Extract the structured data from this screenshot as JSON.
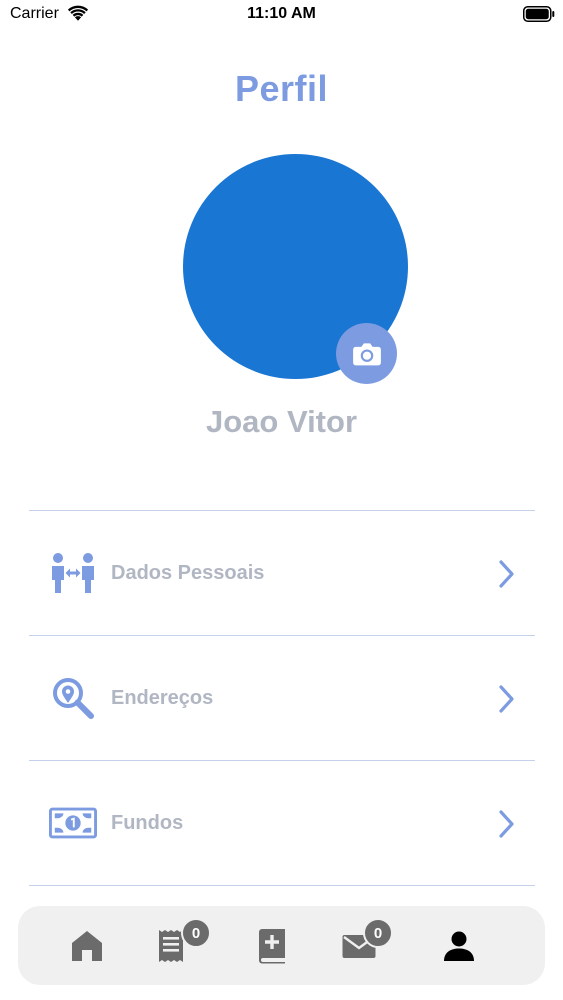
{
  "status_bar": {
    "carrier": "Carrier",
    "time": "11:10 AM"
  },
  "header": {
    "title": "Perfil"
  },
  "profile": {
    "name": "Joao Vitor",
    "avatar_color": "#1976d2",
    "camera_icon": "camera-icon"
  },
  "menu": {
    "items": [
      {
        "label": "Dados Pessoais",
        "icon": "people-exchange-icon"
      },
      {
        "label": "Endereços",
        "icon": "location-search-icon"
      },
      {
        "label": "Fundos",
        "icon": "banknote-icon"
      }
    ]
  },
  "tab_bar": {
    "tabs": [
      {
        "name": "home",
        "icon": "home-icon"
      },
      {
        "name": "receipts",
        "icon": "receipt-icon",
        "badge": "0"
      },
      {
        "name": "book",
        "icon": "medical-book-icon"
      },
      {
        "name": "messages",
        "icon": "mail-icon",
        "badge": "0"
      },
      {
        "name": "profile",
        "icon": "person-icon",
        "active": true
      }
    ]
  },
  "colors": {
    "accent": "#7c9be0",
    "label_gray": "#b1b6c3",
    "divider": "#c5d0ea",
    "tab_icon": "#6b6b6b",
    "tab_active": "#000000"
  }
}
